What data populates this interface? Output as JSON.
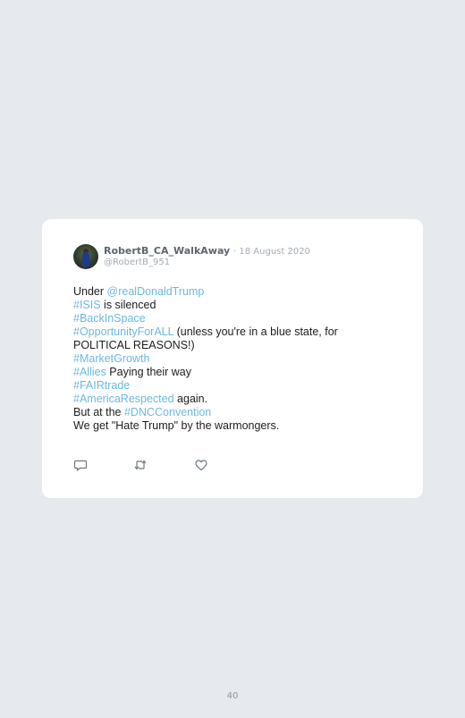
{
  "tweet": {
    "author": {
      "display_name": "RobertB_CA_WalkAway",
      "handle": "@RobertB_951",
      "date": "18 August 2020",
      "separator": "·"
    },
    "lines": [
      {
        "t1": "Under ",
        "h1": "@realDonaldTrump",
        "t2": ""
      },
      {
        "h1": "#ISIS",
        "t2": " is silenced"
      },
      {
        "h1": "#BackInSpace",
        "t2": ""
      },
      {
        "h1": "#OpportunityForALL",
        "t2": " (unless you're in a blue state, for"
      },
      {
        "t1": "POLITICAL REASONS!)"
      },
      {
        "h1": "#MarketGrowth"
      },
      {
        "h1": "#Allies",
        "t2": " Paying their way"
      },
      {
        "h1": "#FAIRtrade"
      },
      {
        "h1": "#AmericaRespected",
        "t2": " again."
      },
      {
        "t1": "But at the ",
        "h1": "#DNCConvention"
      },
      {
        "t1": "We get \"Hate Trump\" by the warmongers."
      }
    ],
    "actions": {
      "reply_icon": "speech-bubble-icon",
      "retweet_icon": "retweet-icon",
      "like_icon": "heart-icon"
    }
  },
  "page": {
    "number": "40"
  },
  "colors": {
    "background": "#e6e9ee",
    "card": "#ffffff",
    "hashtag": "#6cb8e0",
    "meta": "#a4acb5"
  }
}
